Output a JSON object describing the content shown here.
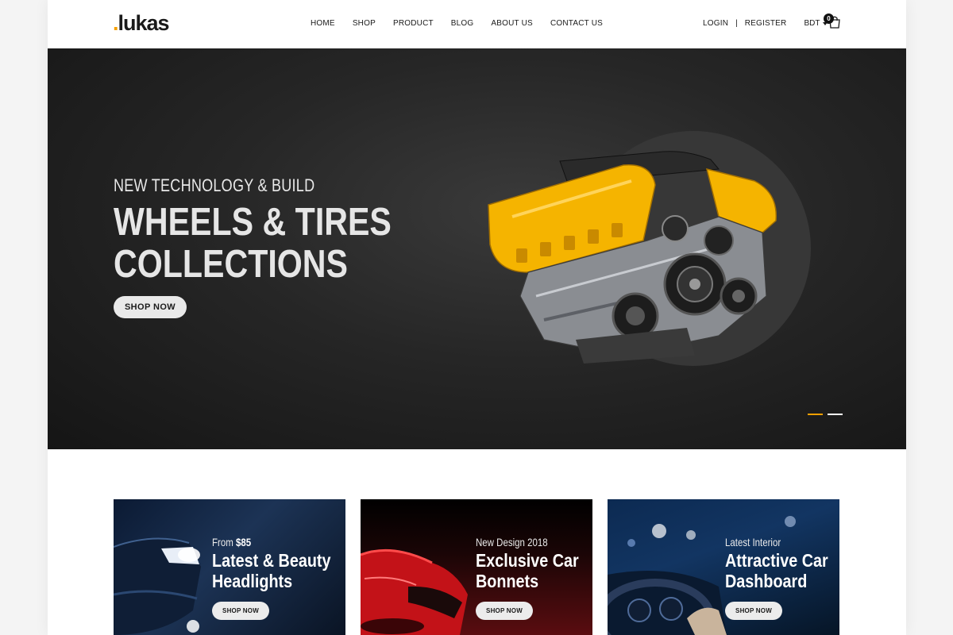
{
  "header": {
    "logo": {
      "accent": ".",
      "text": "lukas"
    },
    "nav": [
      "HOME",
      "SHOP",
      "PRODUCT",
      "BLOG",
      "ABOUT US",
      "CONTACT US"
    ],
    "login": "LOGIN",
    "separator": "|",
    "register": "REGISTER",
    "currency": "BDT",
    "cart_count": "0"
  },
  "hero": {
    "subtitle": "NEW TECHNOLOGY & BUILD",
    "title_line1": "WHEELS & TIRES",
    "title_line2": "COLLECTIONS",
    "button": "SHOP NOW",
    "slides": 2,
    "active_slide": 1
  },
  "banners": [
    {
      "eyebrow_prefix": "From ",
      "eyebrow_bold": "$85",
      "title_line1": "Latest & Beauty",
      "title_line2": "Headlights",
      "button": "SHOP NOW"
    },
    {
      "eyebrow_prefix": "New Design 2018",
      "eyebrow_bold": "",
      "title_line1": "Exclusive Car",
      "title_line2": "Bonnets",
      "button": "SHOP NOW"
    },
    {
      "eyebrow_prefix": "Latest Interior",
      "eyebrow_bold": "",
      "title_line1": "Attractive Car",
      "title_line2": "Dashboard",
      "button": "SHOP NOW"
    }
  ],
  "colors": {
    "accent": "#f5a000",
    "hero_bg": "#222222",
    "text_dark": "#1a1a1a"
  },
  "icons": [
    "cart-icon",
    "chevron-down-icon"
  ]
}
